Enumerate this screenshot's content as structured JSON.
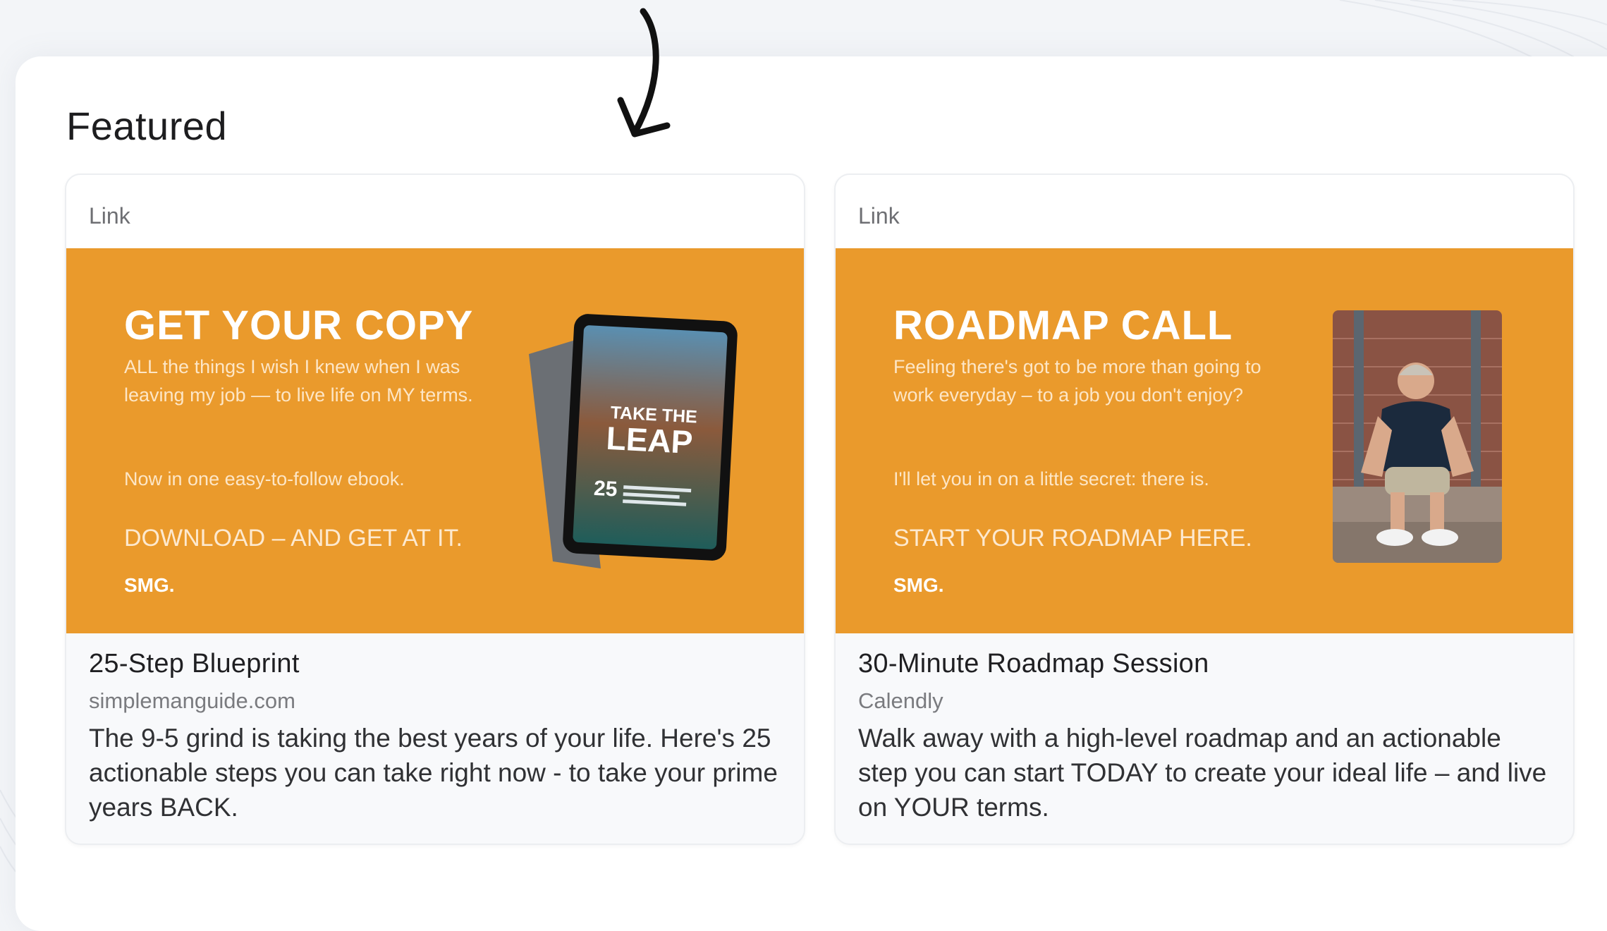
{
  "section": {
    "title": "Featured"
  },
  "cards": [
    {
      "type": "Link",
      "banner": {
        "headline": "GET YOUR COPY",
        "description": "ALL the things I wish I knew when I was leaving my job — to live life on MY terms.",
        "note": "Now in one easy-to-follow ebook.",
        "cta": "DOWNLOAD – AND GET AT IT.",
        "brand": "SMG.",
        "ebook_title_top": "TAKE THE",
        "ebook_title_main": "LEAP",
        "ebook_number": "25"
      },
      "title": "25-Step Blueprint",
      "domain": "simplemanguide.com",
      "description": "The 9-5 grind is taking the best years of your life. Here's 25 actionable steps you can take right now - to take your prime years BACK."
    },
    {
      "type": "Link",
      "banner": {
        "headline": "ROADMAP CALL",
        "description": "Feeling there's got to be more than going to work everyday – to a job you don't enjoy?",
        "note": "I'll let you in on a little secret: there is.",
        "cta": "START YOUR ROADMAP HERE.",
        "brand": "SMG."
      },
      "title": "30-Minute Roadmap Session",
      "domain": "Calendly",
      "description": "Walk away with a high-level roadmap and an actionable step you can start TODAY to create your ideal life – and live on YOUR terms."
    }
  ],
  "colors": {
    "banner_orange": "#ea9a2c",
    "card_background": "#f8f9fb",
    "page_background": "#f3f5f8"
  },
  "icons": [
    "hand-drawn-arrow-icon"
  ]
}
